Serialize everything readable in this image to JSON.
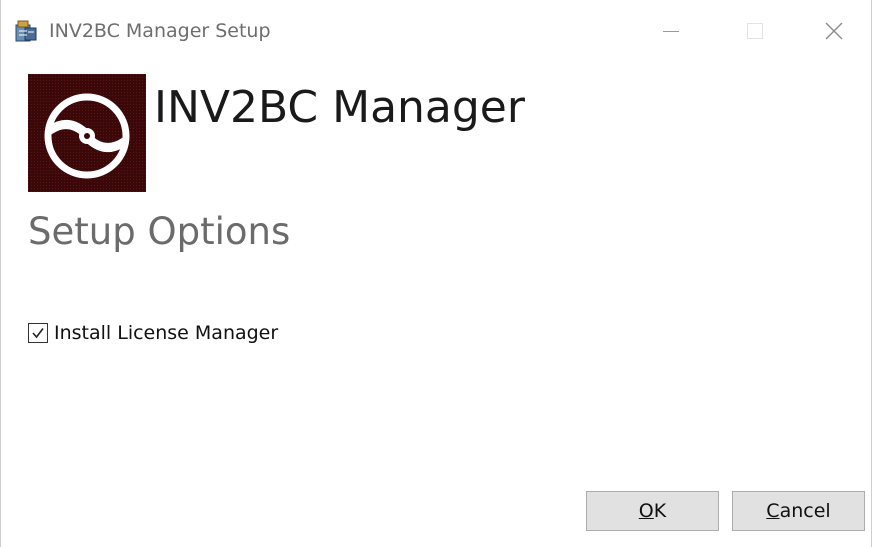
{
  "window": {
    "title": "INV2BC Manager Setup",
    "controls": [
      "minimize-icon",
      "maximize-icon",
      "close-icon"
    ]
  },
  "header": {
    "app_name": "INV2BC Manager",
    "logo_icon": "disc-icon",
    "logo_bg_color": "#3a0a0a"
  },
  "content": {
    "section_title": "Setup Options",
    "options": [
      {
        "label": "Install License Manager",
        "checked": true
      }
    ]
  },
  "buttons": {
    "ok": {
      "mnemonic": "O",
      "rest": "K"
    },
    "cancel": {
      "mnemonic": "C",
      "rest": "ancel"
    }
  }
}
